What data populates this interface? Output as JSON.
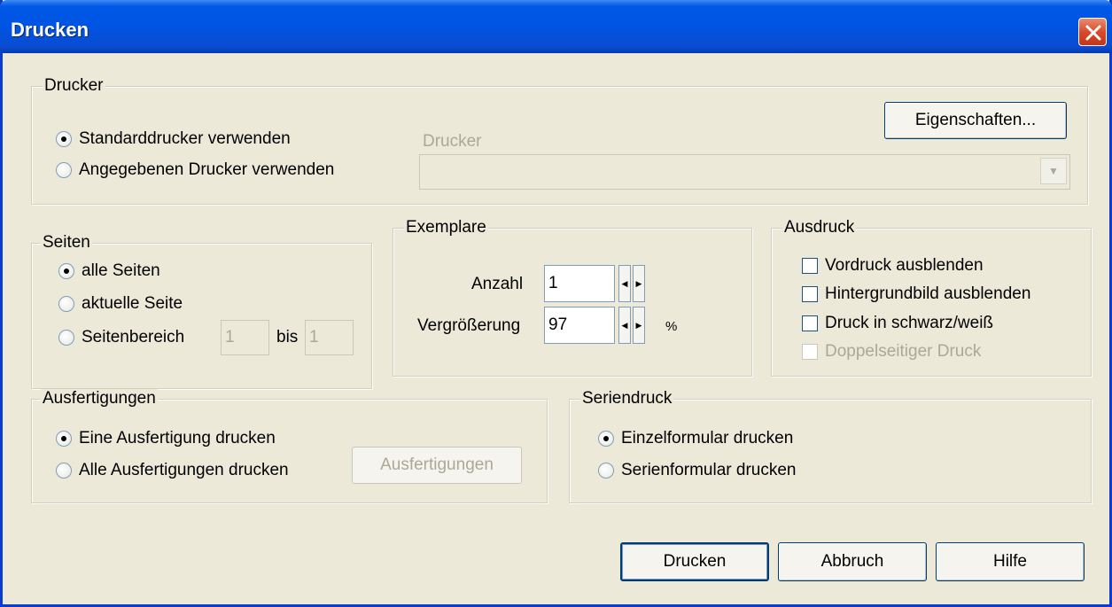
{
  "window": {
    "title": "Drucken"
  },
  "drucker": {
    "legend": "Drucker",
    "option_standard": "Standarddrucker verwenden",
    "option_angegeben": "Angegebenen Drucker verwenden",
    "printer_label": "Drucker",
    "printer_value": "",
    "properties_button": "Eigenschaften..."
  },
  "seiten": {
    "legend": "Seiten",
    "option_all": "alle Seiten",
    "option_current": "aktuelle Seite",
    "option_range": "Seitenbereich",
    "range_from": "1",
    "range_to_label": "bis",
    "range_to": "1"
  },
  "exemplare": {
    "legend": "Exemplare",
    "anzahl_label": "Anzahl",
    "anzahl_value": "1",
    "zoom_label": "Vergrößerung",
    "zoom_value": "97",
    "zoom_unit": "%"
  },
  "ausdruck": {
    "legend": "Ausdruck",
    "items": [
      {
        "label": "Vordruck ausblenden",
        "checked": false,
        "disabled": false
      },
      {
        "label": "Hintergrundbild ausblenden",
        "checked": false,
        "disabled": false
      },
      {
        "label": "Druck in schwarz/weiß",
        "checked": false,
        "disabled": false
      },
      {
        "label": "Doppelseitiger Druck",
        "checked": false,
        "disabled": true
      }
    ]
  },
  "ausfertigungen": {
    "legend": "Ausfertigungen",
    "option_one": "Eine Ausfertigung drucken",
    "option_all": "Alle Ausfertigungen drucken",
    "button": "Ausfertigungen"
  },
  "seriendruck": {
    "legend": "Seriendruck",
    "option_single": "Einzelformular drucken",
    "option_series": "Serienformular drucken"
  },
  "footer": {
    "print_button": "Drucken",
    "cancel_button": "Abbruch",
    "help_button": "Hilfe"
  }
}
